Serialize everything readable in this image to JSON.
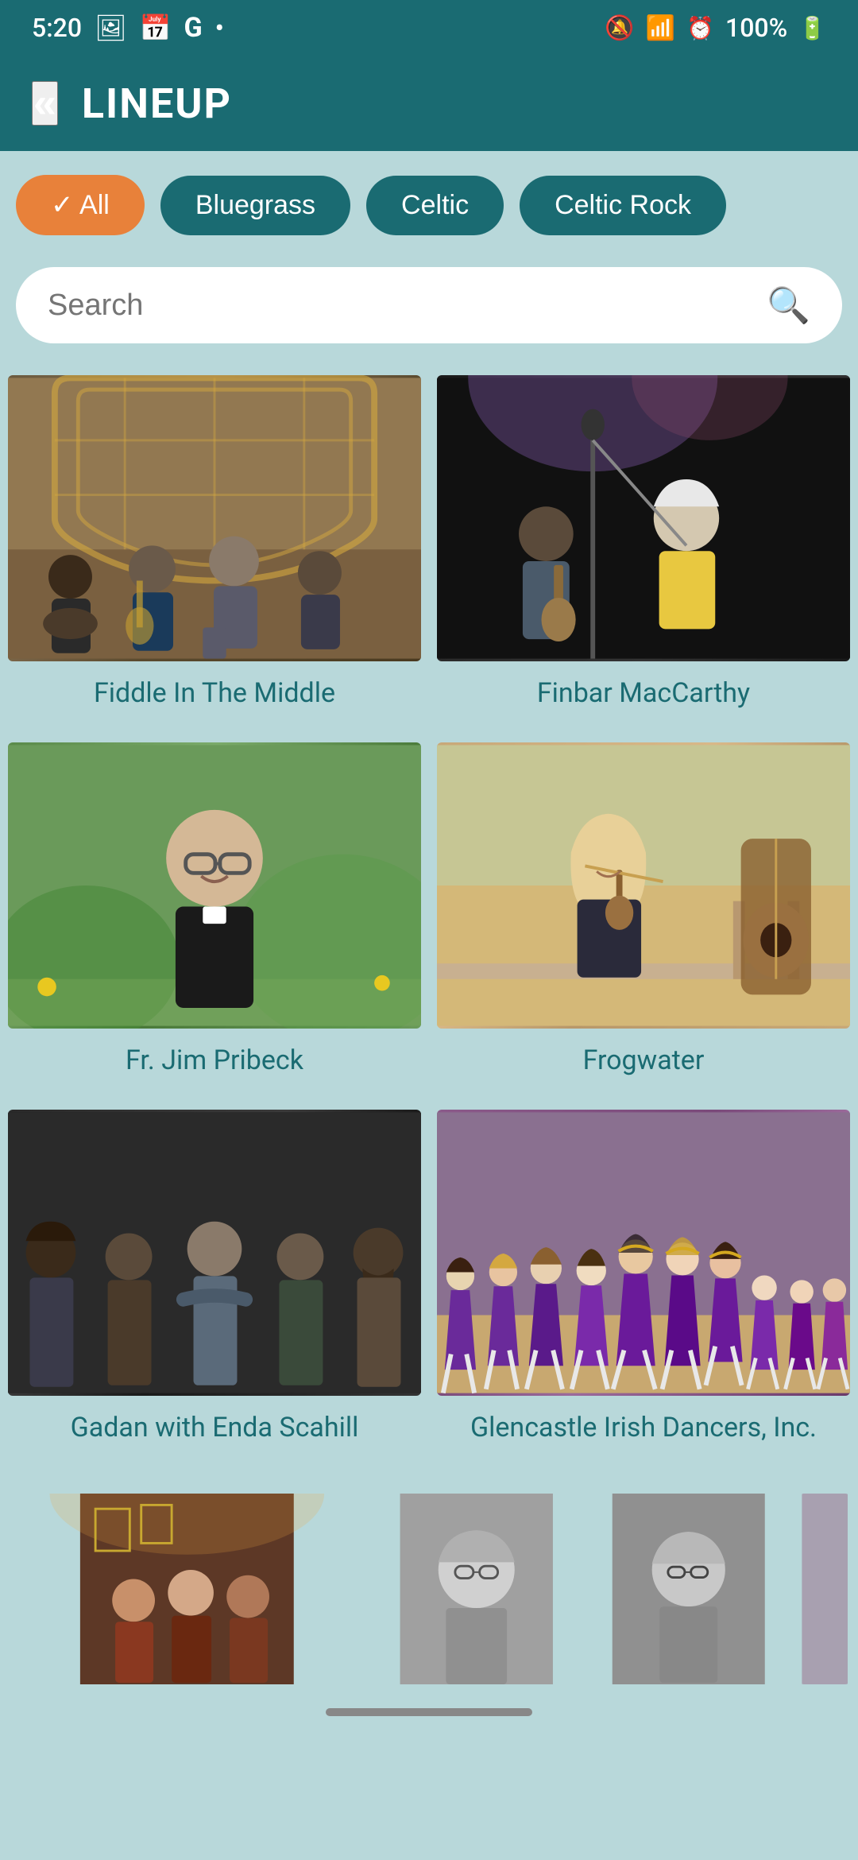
{
  "statusBar": {
    "time": "5:20",
    "batteryPercent": "100%",
    "icons": [
      "photo-icon",
      "calendar-icon",
      "g-icon",
      "dot-icon",
      "mute-icon",
      "wifi-icon",
      "alarm-icon",
      "battery-icon"
    ]
  },
  "header": {
    "backLabel": "«",
    "title": "LINEUP"
  },
  "filters": [
    {
      "id": "all",
      "label": "✓ All",
      "active": true
    },
    {
      "id": "bluegrass",
      "label": "Bluegrass",
      "active": false
    },
    {
      "id": "celtic",
      "label": "Celtic",
      "active": false
    },
    {
      "id": "celtic-rock",
      "label": "Celtic Rock",
      "active": false
    }
  ],
  "search": {
    "placeholder": "Search"
  },
  "artists": [
    {
      "id": "fiddle-in-the-middle",
      "name": "Fiddle In The Middle",
      "bgClass": "fiddle-bg"
    },
    {
      "id": "finbar-maccarthy",
      "name": "Finbar MacCarthy",
      "bgClass": "finbar-bg"
    },
    {
      "id": "fr-jim-pribeck",
      "name": "Fr. Jim Pribeck",
      "bgClass": "frjim-bg"
    },
    {
      "id": "frogwater",
      "name": "Frogwater",
      "bgClass": "frogwater-bg"
    },
    {
      "id": "gadan-enda-scahill",
      "name": "Gadan with Enda Scahill",
      "bgClass": "gadan-bg"
    },
    {
      "id": "glencastle-irish-dancers",
      "name": "Glencastle Irish Dancers, Inc.",
      "bgClass": "glencastle-bg"
    }
  ],
  "partialArtists": [
    {
      "id": "partial-left",
      "bgClass": "partial1-bg"
    },
    {
      "id": "partial-mid",
      "bgClass": "partial2-bg"
    },
    {
      "id": "partial-right",
      "bgClass": "partial2-bg"
    }
  ],
  "colors": {
    "headerBg": "#1a6b72",
    "bodyBg": "#b8d8da",
    "activeFilter": "#e8813a",
    "inactiveFilter": "#1a6b72",
    "artistNameColor": "#1a6b72"
  }
}
